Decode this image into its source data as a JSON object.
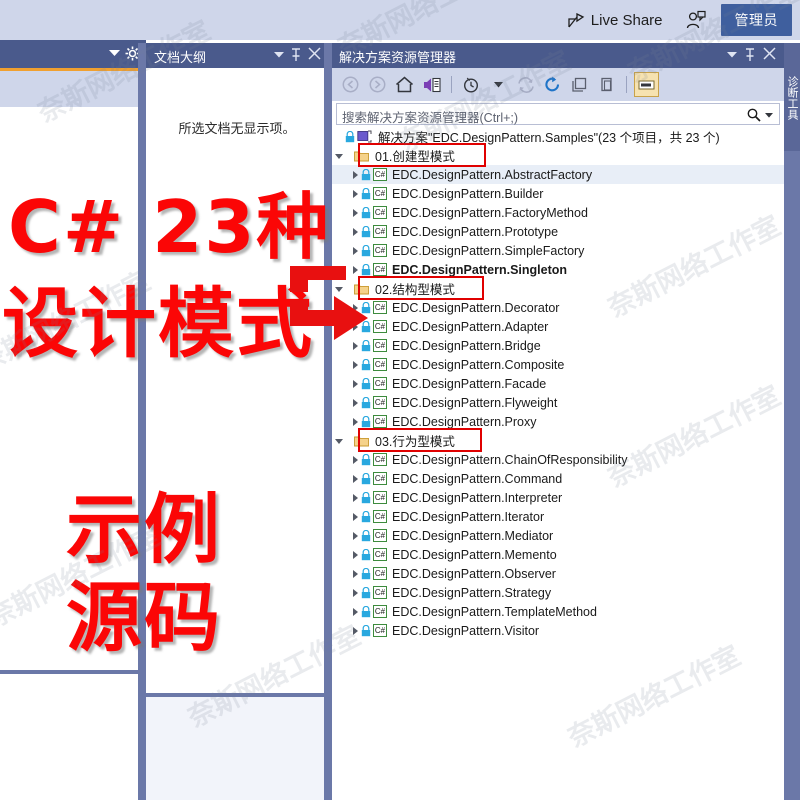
{
  "titlebar": {
    "live_share_label": "Live Share",
    "share_icon": "share-icon",
    "person_icon": "person-add-icon",
    "admin_label": "管理员"
  },
  "left_stub": {
    "chevron_icon": "chevron-down-icon",
    "gear_icon": "gear-icon",
    "combo_value": "",
    "search_icon": "search-icon",
    "list_icon": "list-icon"
  },
  "document_outline": {
    "title": "文档大纲",
    "chevron_icon": "chevron-down-icon",
    "pin_icon": "pin-icon",
    "close_icon": "close-icon",
    "empty_message": "所选文档无显示项。"
  },
  "solution_explorer": {
    "title": "解决方案资源管理器",
    "chevron_icon": "chevron-down-icon",
    "pin_icon": "pin-icon",
    "close_icon": "close-icon",
    "toolbar": [
      {
        "name": "back-icon",
        "label": "",
        "state": "disabled"
      },
      {
        "name": "forward-icon",
        "label": "",
        "state": "disabled"
      },
      {
        "name": "home-icon",
        "label": "",
        "state": "normal"
      },
      {
        "name": "sync-with-active-document-icon",
        "label": "",
        "state": "normal"
      },
      {
        "name": "pending-changes-filter-icon",
        "label": "",
        "state": "normal"
      },
      {
        "name": "refresh-disabled-icon",
        "label": "",
        "state": "disabled"
      },
      {
        "name": "refresh-icon",
        "label": "",
        "state": "normal"
      },
      {
        "name": "collapse-all-icon",
        "label": "",
        "state": "normal"
      },
      {
        "name": "show-all-files-icon",
        "label": "",
        "state": "normal"
      },
      {
        "name": "properties-icon",
        "label": "",
        "state": "active"
      }
    ],
    "search_placeholder": "搜索解决方案资源管理器(Ctrl+;)",
    "search_value": "",
    "search_icon": "search-icon",
    "search_dropdown_icon": "chevron-down-icon"
  },
  "tree": {
    "root": {
      "label": "解决方案\"EDC.DesignPattern.Samples\"(23 个项目，共 23 个)",
      "icon": "solution-icon",
      "lock_icon": "lock-icon"
    },
    "groups": [
      {
        "label": "01.创建型模式",
        "icon": "folder-icon",
        "highlighted": true,
        "projects": [
          {
            "label": "EDC.DesignPattern.AbstractFactory",
            "selected": true,
            "bold": false
          },
          {
            "label": "EDC.DesignPattern.Builder",
            "selected": false,
            "bold": false
          },
          {
            "label": "EDC.DesignPattern.FactoryMethod",
            "selected": false,
            "bold": false
          },
          {
            "label": "EDC.DesignPattern.Prototype",
            "selected": false,
            "bold": false
          },
          {
            "label": "EDC.DesignPattern.SimpleFactory",
            "selected": false,
            "bold": false
          },
          {
            "label": "EDC.DesignPattern.Singleton",
            "selected": false,
            "bold": true
          }
        ]
      },
      {
        "label": "02.结构型模式",
        "icon": "folder-icon",
        "highlighted": true,
        "projects": [
          {
            "label": "EDC.DesignPattern.Decorator",
            "selected": false,
            "bold": false
          },
          {
            "label": "EDC.DesignPattern.Adapter",
            "selected": false,
            "bold": false
          },
          {
            "label": "EDC.DesignPattern.Bridge",
            "selected": false,
            "bold": false
          },
          {
            "label": "EDC.DesignPattern.Composite",
            "selected": false,
            "bold": false
          },
          {
            "label": "EDC.DesignPattern.Facade",
            "selected": false,
            "bold": false
          },
          {
            "label": "EDC.DesignPattern.Flyweight",
            "selected": false,
            "bold": false
          },
          {
            "label": "EDC.DesignPattern.Proxy",
            "selected": false,
            "bold": false
          }
        ]
      },
      {
        "label": "03.行为型模式",
        "icon": "folder-icon",
        "highlighted": true,
        "projects": [
          {
            "label": "EDC.DesignPattern.ChainOfResponsibility",
            "selected": false,
            "bold": false
          },
          {
            "label": "EDC.DesignPattern.Command",
            "selected": false,
            "bold": false
          },
          {
            "label": "EDC.DesignPattern.Interpreter",
            "selected": false,
            "bold": false
          },
          {
            "label": "EDC.DesignPattern.Iterator",
            "selected": false,
            "bold": false
          },
          {
            "label": "EDC.DesignPattern.Mediator",
            "selected": false,
            "bold": false
          },
          {
            "label": "EDC.DesignPattern.Memento",
            "selected": false,
            "bold": false
          },
          {
            "label": "EDC.DesignPattern.Observer",
            "selected": false,
            "bold": false
          },
          {
            "label": "EDC.DesignPattern.Strategy",
            "selected": false,
            "bold": false
          },
          {
            "label": "EDC.DesignPattern.TemplateMethod",
            "selected": false,
            "bold": false
          },
          {
            "label": "EDC.DesignPattern.Visitor",
            "selected": false,
            "bold": false
          }
        ]
      }
    ]
  },
  "right_tab": {
    "label": "诊断工具"
  },
  "overlay": {
    "line1": "C# 23种",
    "line2": "设计模式",
    "line3": "示例",
    "line4": "源码",
    "color": "#fb0606",
    "arrow_icon": "red-arrow-icon"
  },
  "watermark": {
    "text": "奈斯网络工作室"
  },
  "colors": {
    "titlebar_bg": "#cfd6ea",
    "panel_header_bg": "#4a5a8c",
    "divider": "#6b78a8",
    "accent_orange": "#f0a030",
    "admin_button": "#3f5f9e",
    "selection": "#e8eef7",
    "red_highlight": "#e00000"
  }
}
